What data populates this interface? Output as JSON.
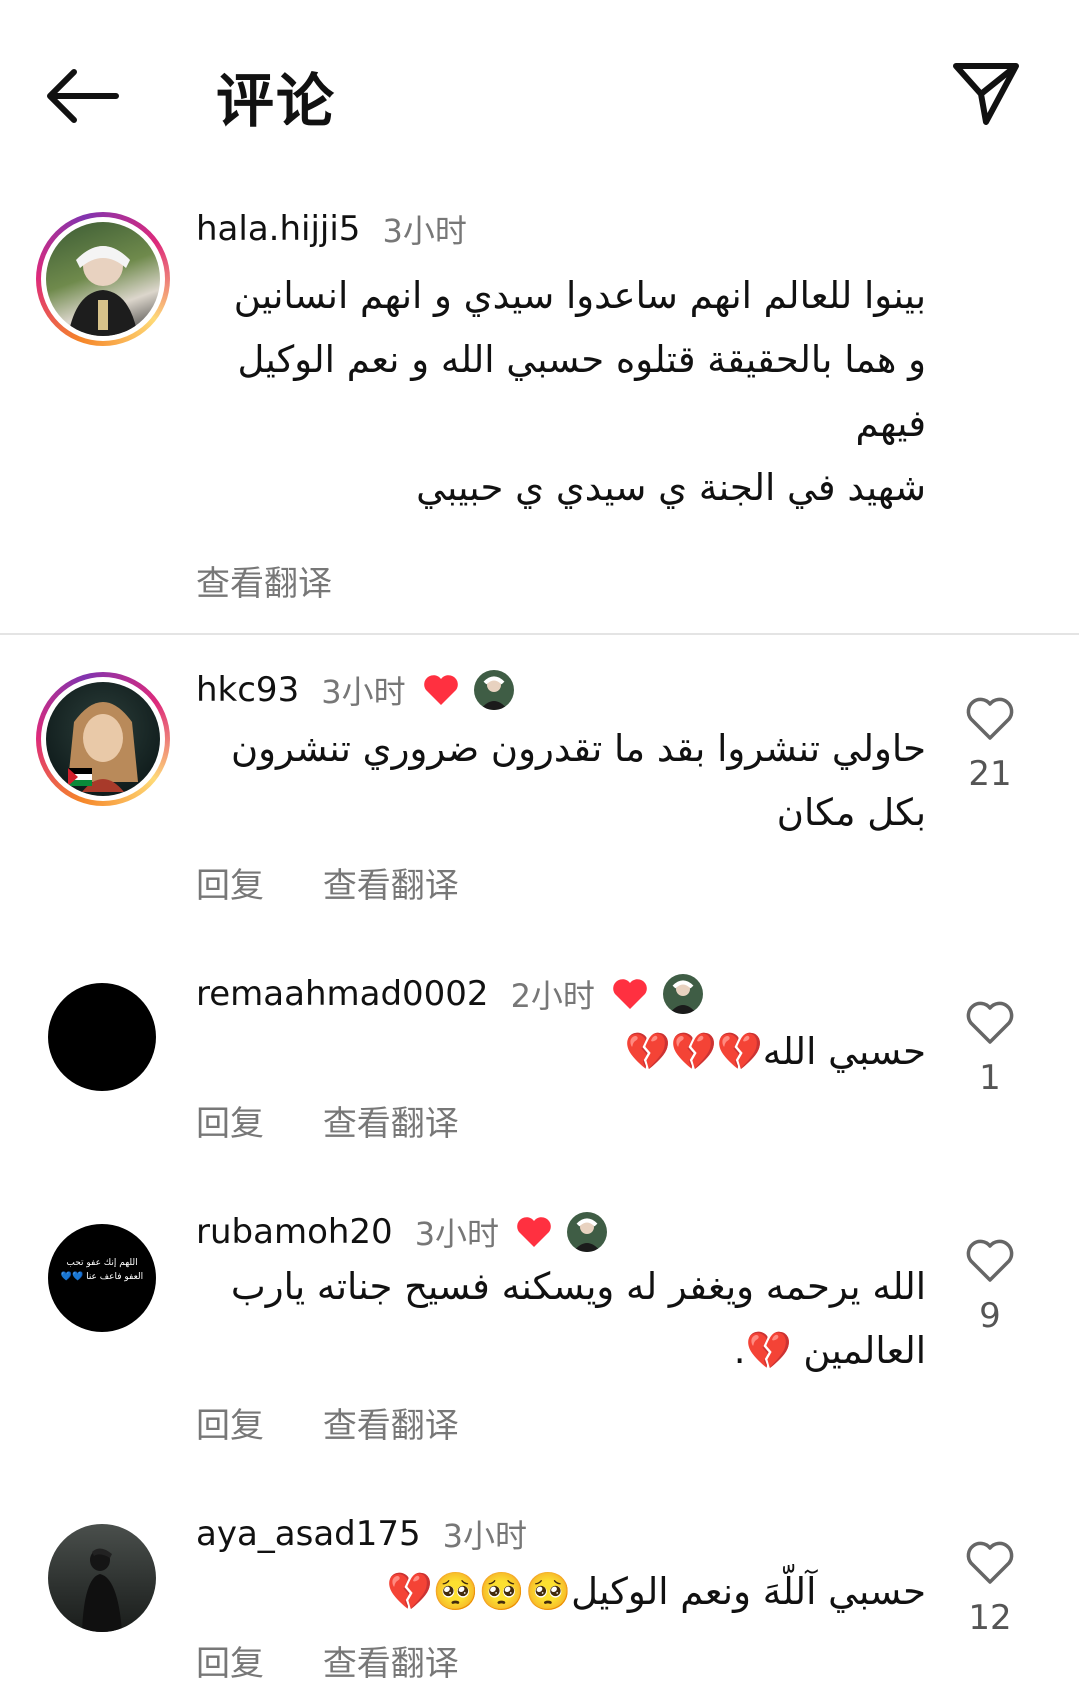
{
  "header": {
    "title": "评论"
  },
  "caption": {
    "username": "hala.hijji5",
    "time": "3小时",
    "lines": [
      "بينوا للعالم انهم ساعدوا سيدي و انهم انسانين",
      "و هما بالحقيقة قتلوه حسبي الله و نعم الوكيل",
      "فيهم",
      "شهيد في الجنة ي سيدي ي حبيبي"
    ],
    "translate": "查看翻译"
  },
  "comments": [
    {
      "username": "hkc93",
      "time": "3小时",
      "lines": [
        "حاولي تنشروا بقد ما تقدرون ضروري تنشرون",
        "بكل مكان"
      ],
      "reply": "回复",
      "translate": "查看翻译",
      "likes": "21"
    },
    {
      "username": "remaahmad0002",
      "time": "2小时",
      "lines": [
        "حسبي الله💔💔💔"
      ],
      "reply": "回复",
      "translate": "查看翻译",
      "likes": "1"
    },
    {
      "username": "rubamoh20",
      "time": "3小时",
      "lines": [
        "الله يرحمه ويغفر له ويسكنه فسيح جناته يارب",
        "العالمين 💔."
      ],
      "reply": "回复",
      "translate": "查看翻译",
      "likes": "9",
      "avatar_text": "اللهم إنك عفو تحب العفو فاعف عنا 💙💙"
    },
    {
      "username": "aya_asad175",
      "time": "3小时",
      "lines": [
        "حسبي آللّهَ ونعم الوكيل🥺🥺🥺💔"
      ],
      "reply": "回复",
      "translate": "查看翻译",
      "likes": "12"
    }
  ],
  "colors": {
    "heart_red": "#ff3040",
    "muted_text": "#777777"
  }
}
